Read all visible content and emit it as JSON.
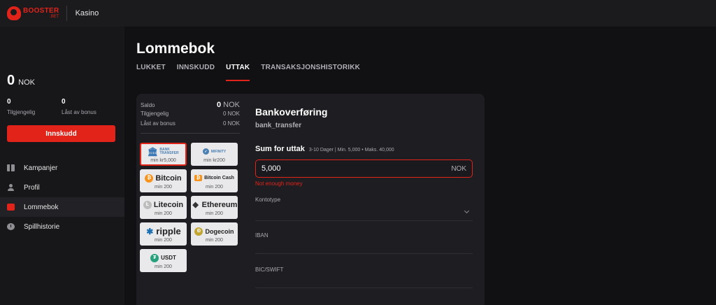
{
  "header": {
    "logo_word": "BOOSTER",
    "logo_sub": ".BET",
    "nav_kasino": "Kasino"
  },
  "sidebar": {
    "balance_value": "0",
    "balance_currency": "NOK",
    "available_value": "0",
    "available_label": "Tilgjengelig",
    "bonus_locked_value": "0",
    "bonus_locked_label": "Låst av bonus",
    "deposit_label": "Innskudd",
    "items": [
      {
        "label": "Kampanjer",
        "icon": "gift-icon"
      },
      {
        "label": "Profil",
        "icon": "user-icon"
      },
      {
        "label": "Lommebok",
        "icon": "wallet-icon",
        "active": true
      },
      {
        "label": "Spillhistorie",
        "icon": "clock-icon"
      }
    ]
  },
  "page": {
    "title": "Lommebok",
    "tabs": [
      {
        "label": "LUKKET"
      },
      {
        "label": "INNSKUDD"
      },
      {
        "label": "UTTAK",
        "active": true
      },
      {
        "label": "TRANSAKSJONSHISTORIKK"
      }
    ]
  },
  "summary": {
    "saldo_label": "Saldo",
    "saldo_value": "0",
    "saldo_currency": "NOK",
    "available_label": "Tilgjengelig",
    "available_value": "0 NOK",
    "bonus_label": "Låst av bonus",
    "bonus_value": "0 NOK"
  },
  "methods": [
    {
      "name": "BANK TRANSFER",
      "line1": "BANK",
      "line2": "TRANSFER",
      "min": "min kr5,000",
      "selected": true,
      "icon": "bank-icon"
    },
    {
      "name": "MIFINITY",
      "min": "min kr200",
      "icon": "mifinity-icon"
    },
    {
      "name": "Bitcoin",
      "min": "min 200",
      "icon": "bitcoin-icon",
      "glyph": "₿"
    },
    {
      "name": "Bitcoin Cash",
      "min": "min 200",
      "icon": "bitcoin-cash-icon",
      "glyph": "₿"
    },
    {
      "name": "Litecoin",
      "min": "min 200",
      "icon": "litecoin-icon",
      "glyph": "Ł"
    },
    {
      "name": "Ethereum",
      "min": "min 200",
      "icon": "ethereum-icon",
      "glyph": "◆"
    },
    {
      "name": "ripple",
      "min": "min 200",
      "icon": "ripple-icon",
      "glyph": "✱"
    },
    {
      "name": "Dogecoin",
      "min": "min 200",
      "icon": "dogecoin-icon",
      "glyph": "Ð"
    },
    {
      "name": "USDT",
      "min": "min 200",
      "icon": "tether-icon",
      "glyph": "₮"
    }
  ],
  "form": {
    "title": "Bankoverføring",
    "subtitle": "bank_transfer",
    "amount_label": "Sum for uttak",
    "amount_info": "3-10 Dager | Min. 5,000 • Maks. 40,000",
    "amount_value": "5,000",
    "amount_currency": "NOK",
    "error": "Not enough money",
    "account_type_label": "Kontotype",
    "iban_label": "IBAN",
    "bic_label": "BIC/SWIFT"
  },
  "colors": {
    "accent": "#e2231a",
    "background": "#111114",
    "card": "#1e1e22"
  }
}
